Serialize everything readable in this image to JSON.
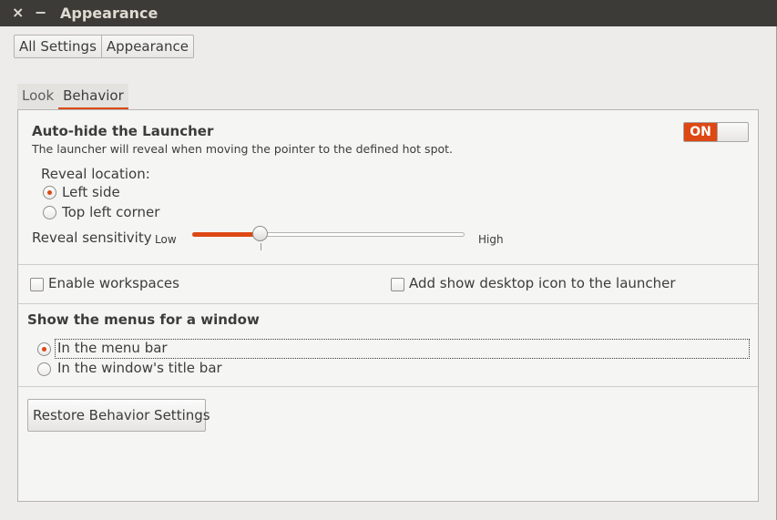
{
  "window": {
    "title": "Appearance",
    "close_label": "×",
    "minimize_label": "−"
  },
  "breadcrumb": [
    "All Settings",
    "Appearance"
  ],
  "tabs": [
    {
      "label": "Look",
      "active": false
    },
    {
      "label": "Behavior",
      "active": true
    }
  ],
  "launcher": {
    "title": "Auto-hide the Launcher",
    "description": "The launcher will reveal when moving the pointer to the defined hot spot.",
    "toggle_label": "ON",
    "reveal_location_label": "Reveal location:",
    "options": [
      {
        "label": "Left side",
        "checked": true
      },
      {
        "label": "Top left corner",
        "checked": false
      }
    ],
    "sensitivity": {
      "label": "Reveal sensitivity",
      "low": "Low",
      "high": "High",
      "value": 0.25
    }
  },
  "workspaces": {
    "enable_label": "Enable workspaces",
    "enable_checked": false,
    "desktop_icon_label": "Add show desktop icon to the launcher",
    "desktop_icon_checked": false
  },
  "menus": {
    "title": "Show the menus for a window",
    "options": [
      {
        "label": "In the menu bar",
        "checked": true
      },
      {
        "label": "In the window's title bar",
        "checked": false
      }
    ]
  },
  "restore_button": "Restore Behavior Settings",
  "colors": {
    "accent": "#dd4814",
    "titlebar": "#3c3b37"
  }
}
